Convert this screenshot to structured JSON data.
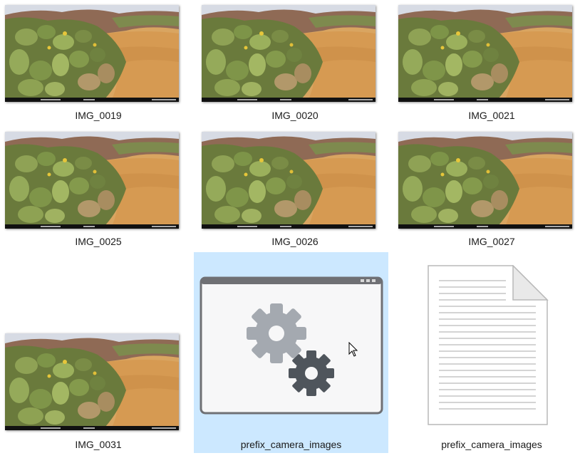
{
  "files": [
    {
      "name": "IMG_0019",
      "type": "image"
    },
    {
      "name": "IMG_0020",
      "type": "image"
    },
    {
      "name": "IMG_0021",
      "type": "image"
    },
    {
      "name": "IMG_0025",
      "type": "image"
    },
    {
      "name": "IMG_0026",
      "type": "image"
    },
    {
      "name": "IMG_0027",
      "type": "image"
    },
    {
      "name": "IMG_0031",
      "type": "image"
    },
    {
      "name": "prefix_camera_images",
      "type": "application",
      "selected": true,
      "icon": "gears-app-icon"
    },
    {
      "name": "prefix_camera_images",
      "type": "document",
      "icon": "text-document-icon"
    }
  ],
  "colors": {
    "selection": "#cce8ff",
    "caption_text": "#1b1b1b"
  }
}
